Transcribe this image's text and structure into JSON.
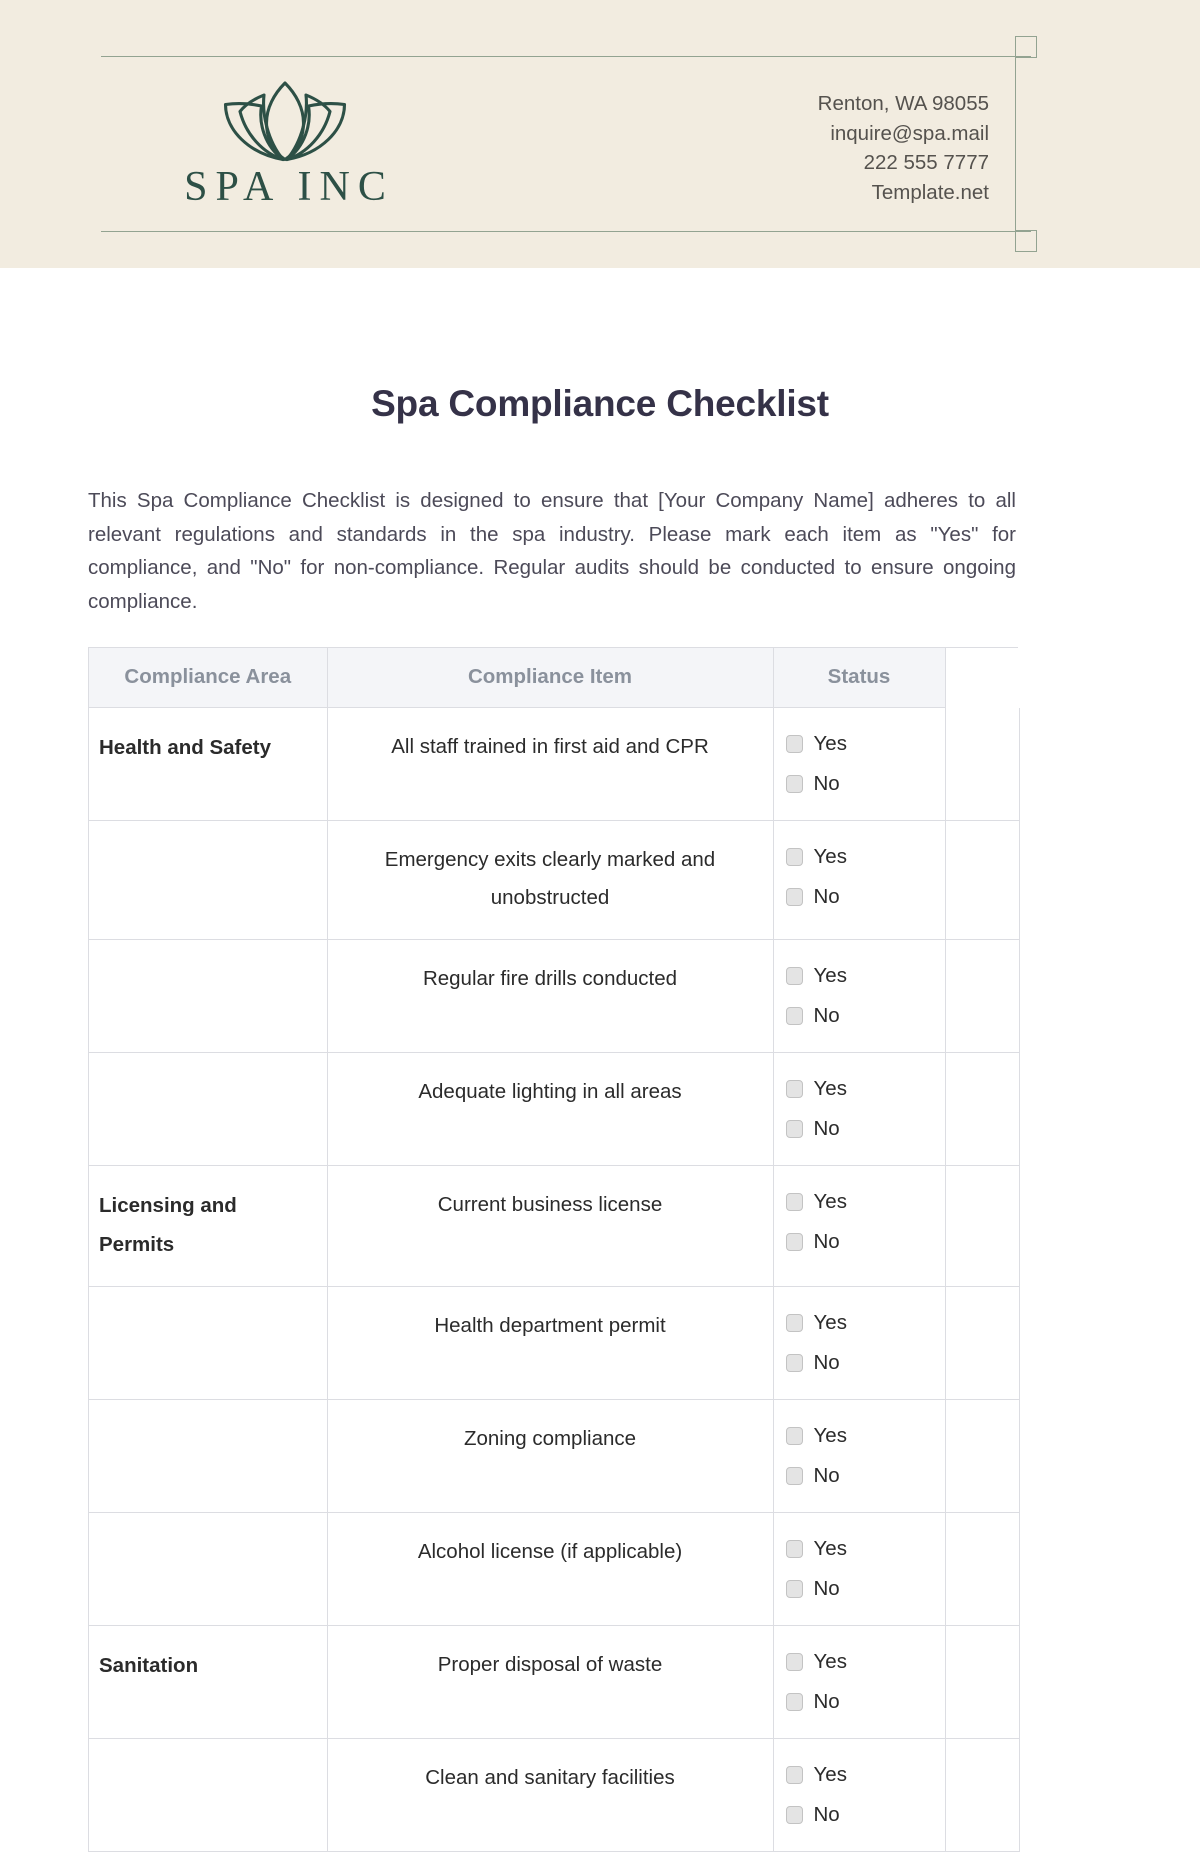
{
  "letterhead": {
    "logo": {
      "icon": "lotus-flower-icon",
      "wordmark": "SPA INC",
      "color": "#2d5046"
    },
    "contact_lines": [
      "Renton, WA 98055",
      "inquire@spa.mail",
      "222 555 7777",
      "Template.net"
    ],
    "band_color": "#f2ece0",
    "rule_color": "#93a391"
  },
  "document": {
    "title": "Spa Compliance Checklist",
    "intro": "This Spa Compliance Checklist is designed to ensure that [Your Company Name] adheres to all relevant regulations and standards in the spa industry. Please mark each item as \"Yes\" for compliance, and \"No\" for non-compliance. Regular audits should be conducted to ensure ongoing compliance."
  },
  "table": {
    "headers": [
      "Compliance Area",
      "Compliance Item",
      "Status",
      ""
    ],
    "options": [
      "Yes",
      "No"
    ],
    "rows": [
      {
        "area": "Health and Safety",
        "item": "All staff trained in first aid and CPR",
        "options": [
          "Yes",
          "No"
        ]
      },
      {
        "area": "",
        "item": "Emergency exits clearly marked and unobstructed",
        "options": [
          "Yes",
          "No"
        ]
      },
      {
        "area": "",
        "item": "Regular fire drills conducted",
        "options": [
          "Yes",
          "No"
        ]
      },
      {
        "area": "",
        "item": "Adequate lighting in all areas",
        "options": [
          "Yes",
          "No"
        ]
      },
      {
        "area": "Licensing and Permits",
        "item": "Current business license",
        "options": [
          "Yes",
          "No"
        ]
      },
      {
        "area": "",
        "item": "Health department permit",
        "options": [
          "Yes",
          "No"
        ]
      },
      {
        "area": "",
        "item": "Zoning compliance",
        "options": [
          "Yes",
          "No"
        ]
      },
      {
        "area": "",
        "item": "Alcohol license (if applicable)",
        "options": [
          "Yes",
          "No"
        ]
      },
      {
        "area": "Sanitation",
        "item": "Proper disposal of waste",
        "options": [
          "Yes",
          "No"
        ]
      },
      {
        "area": "",
        "item": "Clean and sanitary facilities",
        "options": [
          "Yes",
          "No"
        ]
      }
    ]
  },
  "colors": {
    "title": "#353248",
    "body_text": "#4c4a58",
    "table_header_bg": "#f4f5f8",
    "table_header_text": "#8a919c",
    "table_border": "#dcdde2",
    "checkbox_fill": "#e4e4e4"
  }
}
